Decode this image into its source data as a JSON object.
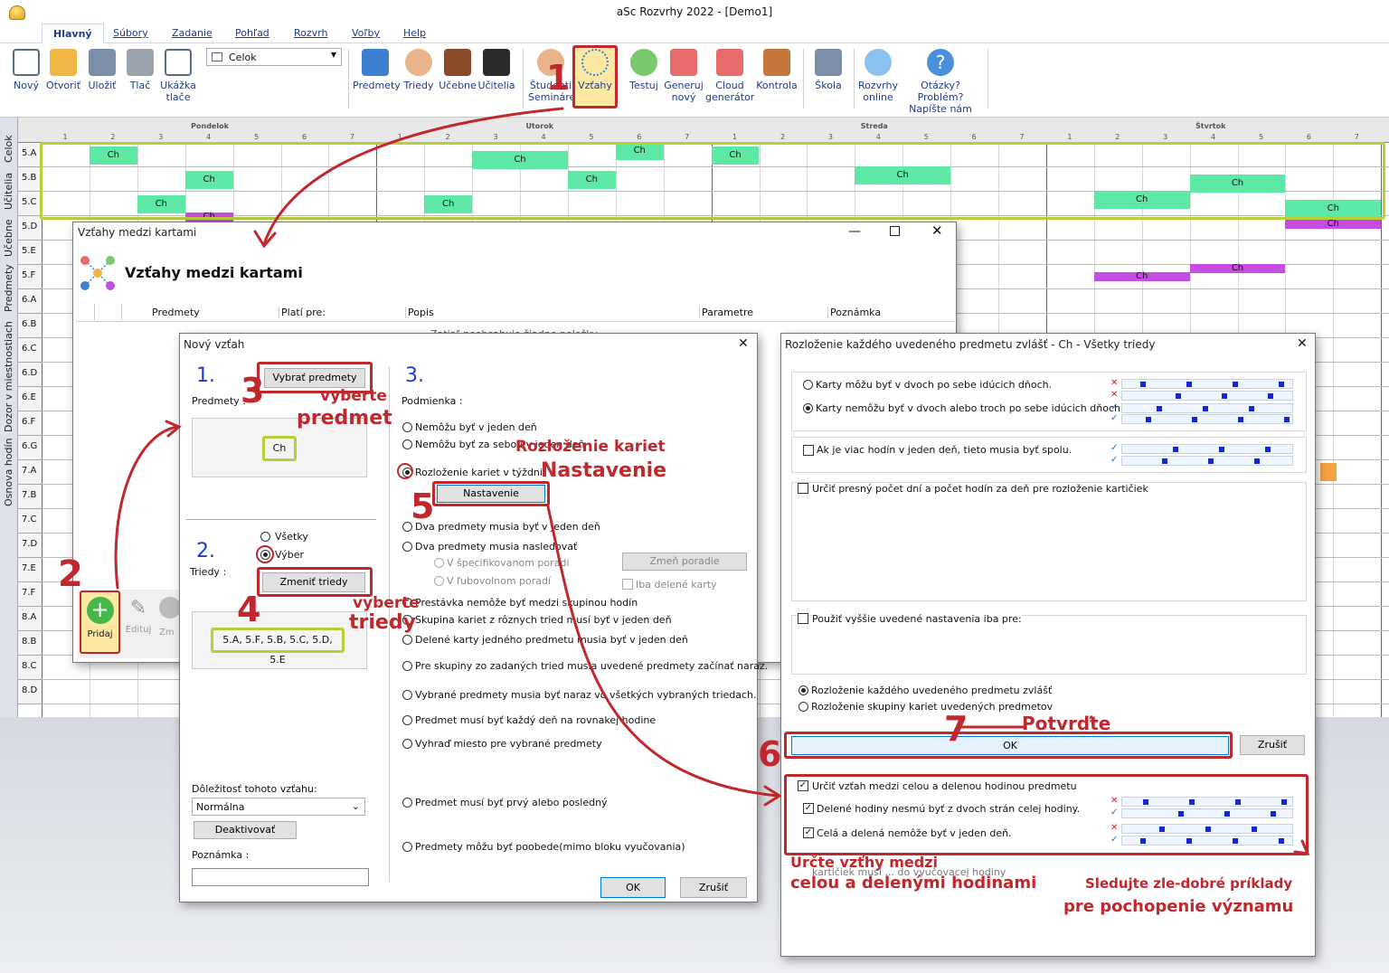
{
  "window": {
    "title": "aSc Rozvrhy 2022  - [Demo1]"
  },
  "menu": [
    "Hlavný",
    "Súbory",
    "Zadanie",
    "Pohľad",
    "Rozvrh",
    "Voľby",
    "Help"
  ],
  "ribbon": {
    "new": "Nový",
    "open": "Otvoriť",
    "save": "Uložiť",
    "print": "Tlač",
    "preview1": "Ukážka",
    "preview2": "tlače",
    "combo": "Celok",
    "subjects": "Predmety",
    "classes": "Triedy",
    "rooms": "Učebne",
    "teachers": "Učitelia",
    "students1": "Študenti",
    "students2": "Semináre",
    "relations": "Vzťahy",
    "test": "Testuj",
    "gen1": "Generuj",
    "gen2": "nový",
    "cloud1": "Cloud",
    "cloud2": "generátor",
    "check": "Kontrola",
    "school": "Škola",
    "online1": "Rozvrhy",
    "online2": "online",
    "help1": "Otázky? Problém?",
    "help2": "Napíšte nám"
  },
  "timetable": {
    "days": [
      "Pondelok",
      "Utorok",
      "Streda",
      "Štvrtok"
    ],
    "periods": [
      "1",
      "2",
      "3",
      "4",
      "5",
      "6",
      "7"
    ],
    "rows": [
      "5.A",
      "5.B",
      "5.C",
      "5.D",
      "5.E",
      "5.F",
      "6.A",
      "6.B",
      "6.C",
      "6.D",
      "6.E",
      "6.F",
      "6.G",
      "7.A",
      "7.B",
      "7.C",
      "7.D",
      "7.E",
      "7.F",
      "8.A",
      "8.B",
      "8.C",
      "8.D"
    ],
    "card": "Ch",
    "side_tabs": [
      "Celok",
      "Učitelia",
      "Učebne",
      "Predmety",
      "Dozor v miestnostiach",
      "Osnova hodín"
    ]
  },
  "relations_dlg": {
    "title": "Vzťahy medzi kartami",
    "heading": "Vzťahy medzi kartami",
    "cols": [
      "Predmety",
      "Platí pre:",
      "Popis",
      "Parametre",
      "Poznámka"
    ],
    "empty": "Zatiaľ neobsahuje žiadne položky",
    "add": "Pridaj",
    "edit": "Edituj",
    "remove": "Zm"
  },
  "new_rel": {
    "title": "Nový vzťah",
    "step1": "1.",
    "subjects_lbl": "Predmety :",
    "choose_subjects": "Vybrať predmety",
    "subject_value": "Ch",
    "step2": "2.",
    "classes_lbl": "Triedy :",
    "all": "Všetky",
    "selection": "Výber",
    "change_classes": "Zmeniť triedy",
    "classes_value": "5.A, 5.F, 5.B, 5.C, 5.D, 5.E",
    "step3": "3.",
    "condition": "Podmienka :",
    "options": [
      "Nemôžu byť v jeden deň",
      "Nemôžu byť za sebou v jeden deň",
      "Rozloženie kariet v týždni",
      "Dva predmety musia byť v jeden deň",
      "Dva predmety musia nasledovať",
      "Prestávka nemôže byť medzi skupinou hodín",
      "Skupina kariet z rôznych tried musí byť v jeden deň",
      "Delené karty jedného predmetu musia byť v jeden deň",
      "Pre skupiny zo zadaných tried musia uvedené predmety začínať naraz.",
      "Vybrané predmety musia byť naraz vo všetkých vybraných triedach.",
      "Predmet musí byť každý deň na rovnakej hodine",
      "Vyhraď miesto pre vybrané predmety",
      "Predmet musí byť prvý alebo posledný",
      "Predmety môžu byť poobede(mimo bloku vyučovania)"
    ],
    "settings": "Nastavenie",
    "change_order": "Zmeň poradie",
    "spec_order": "V špecifikovanom poradí",
    "any_order": "V ľubovolnom poradí",
    "split_only": "Iba delené karty",
    "importance_lbl": "Dôležitosť tohoto vzťahu:",
    "importance": "Normálna",
    "deactivate": "Deaktivovať",
    "note_lbl": "Poznámka :",
    "ok": "OK",
    "cancel": "Zrušiť"
  },
  "spread_dlg": {
    "title": "Rozloženie každého uvedeného predmetu zvlášť - Ch - Všetky triedy",
    "opt1": "Karty môžu byť v dvoch po sebe idúcich dňoch.",
    "opt2": "Karty nemôžu byť v dvoch alebo troch po sebe idúcich dňoch.",
    "opt3": "Ak je viac hodín v jeden deň, tieto musia byť spolu.",
    "opt4": "Určiť presný počet dní a počet hodín za deň pre rozloženie kartičiek",
    "opt5": "Použiť vyššie uvedené nastavenia iba pre:",
    "opt6": "Rozloženie každého uvedeného predmetu zvlášť",
    "opt7": "Rozloženie skupiny kariet uvedených predmetov",
    "ok": "OK",
    "cancel": "Zrušiť",
    "opt8": "Určiť vzťah medzi celou a delenou hodinou predmetu",
    "opt9": "Delené hodiny nesmú byť z dvoch strán celej hodiny.",
    "opt10": "Celá a delená nemôže byť v jeden deň.",
    "opt11": "kartičiek musí ... do vyučovacej hodiny"
  },
  "annotations": {
    "n1": "1",
    "n2": "2",
    "n3": "3",
    "n4": "4",
    "n5": "5",
    "n6": "6",
    "n7": "7",
    "a3a": "vyberte",
    "a3b": "predmet",
    "a4a": "vyberte",
    "a4b": "triedy",
    "a5a": "Rozloženie kariet",
    "a5b": "Nastavenie",
    "a7": "Potvrďte",
    "a6a": "Určte vzťhy medzi",
    "a6b": "celou a delenými hodinami",
    "a8a": "Sledujte zle-dobré príklady",
    "a8b": "pre pochopenie významu"
  },
  "colors": {
    "green_card": "#5ee8a5",
    "purple_card": "#c64ce4",
    "annot": "#c0282d",
    "highlight": "#b8cf3a"
  }
}
